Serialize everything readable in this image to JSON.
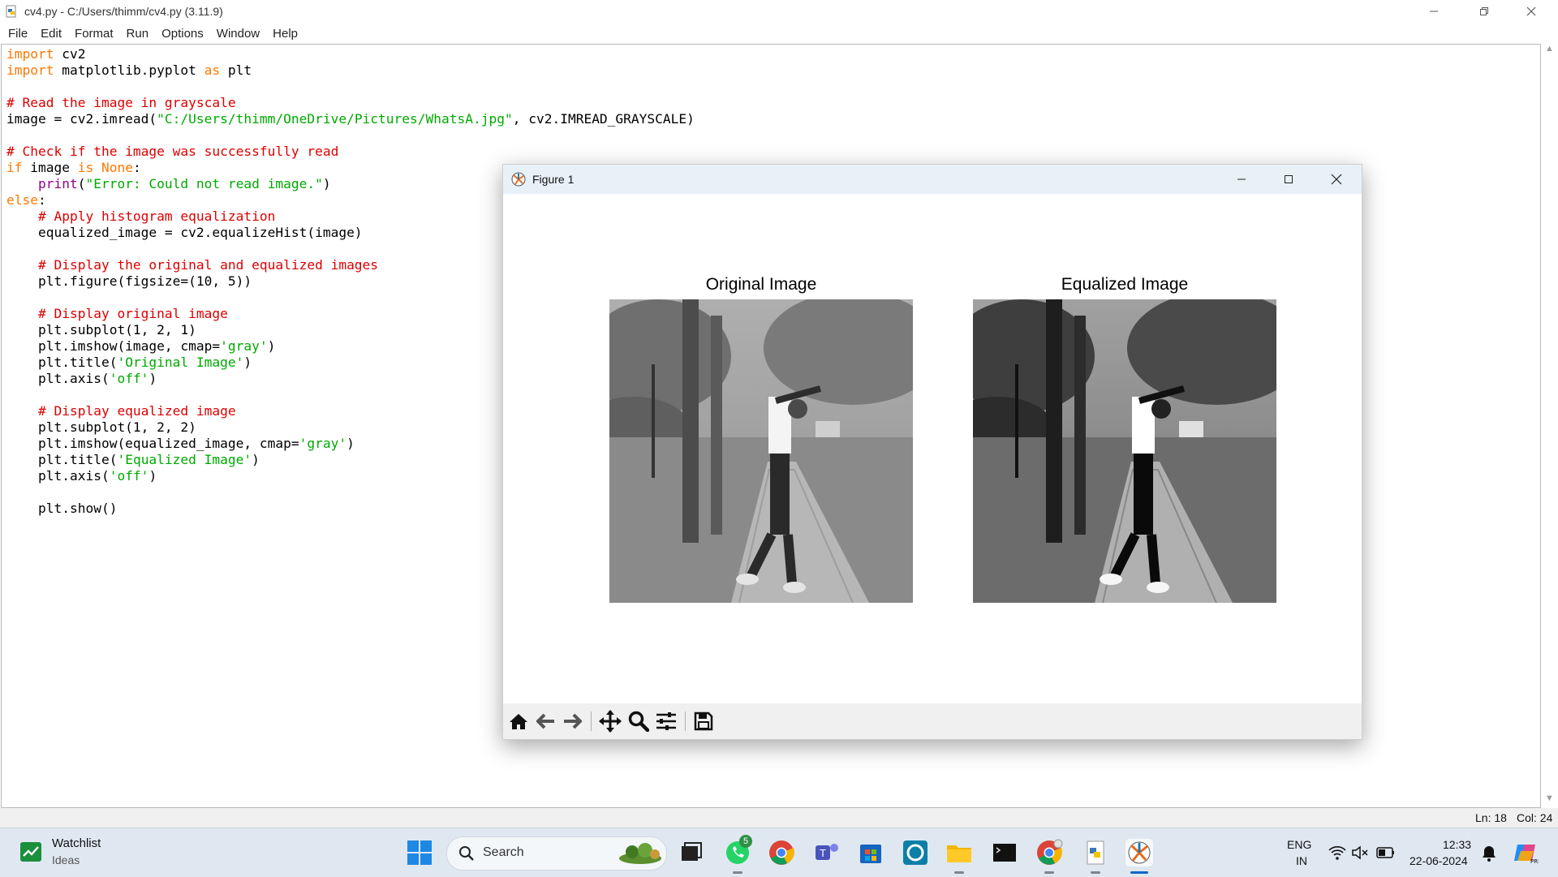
{
  "window": {
    "title": "cv4.py - C:/Users/thimm/cv4.py (3.11.9)",
    "minimize_icon": "minimize-icon",
    "restore_icon": "restore-icon",
    "close_icon": "close-icon"
  },
  "menu": [
    "File",
    "Edit",
    "Format",
    "Run",
    "Options",
    "Window",
    "Help"
  ],
  "code_lines": [
    [
      {
        "t": "import",
        "c": "kw"
      },
      {
        "t": " cv2",
        "c": ""
      }
    ],
    [
      {
        "t": "import",
        "c": "kw"
      },
      {
        "t": " matplotlib.pyplot ",
        "c": ""
      },
      {
        "t": "as",
        "c": "kw"
      },
      {
        "t": " plt",
        "c": ""
      }
    ],
    [],
    [
      {
        "t": "# Read the image in grayscale",
        "c": "cm"
      }
    ],
    [
      {
        "t": "image = cv2.imread(",
        "c": ""
      },
      {
        "t": "\"C:/Users/thimm/OneDrive/Pictures/WhatsA.jpg\"",
        "c": "st"
      },
      {
        "t": ", cv2.IMREAD_GRAYSCALE)",
        "c": ""
      }
    ],
    [],
    [
      {
        "t": "# Check if the image was successfully read",
        "c": "cm"
      }
    ],
    [
      {
        "t": "if",
        "c": "kw"
      },
      {
        "t": " image ",
        "c": ""
      },
      {
        "t": "is",
        "c": "kw"
      },
      {
        "t": " ",
        "c": ""
      },
      {
        "t": "None",
        "c": "kw"
      },
      {
        "t": ":",
        "c": ""
      }
    ],
    [
      {
        "t": "    ",
        "c": ""
      },
      {
        "t": "print",
        "c": "bi"
      },
      {
        "t": "(",
        "c": ""
      },
      {
        "t": "\"Error: Could not read image.\"",
        "c": "st"
      },
      {
        "t": ")",
        "c": ""
      }
    ],
    [
      {
        "t": "else",
        "c": "kw"
      },
      {
        "t": ":",
        "c": ""
      }
    ],
    [
      {
        "t": "    ",
        "c": ""
      },
      {
        "t": "# Apply histogram equalization",
        "c": "cm"
      }
    ],
    [
      {
        "t": "    equalized_image = cv2.equalizeHist(image)",
        "c": ""
      }
    ],
    [],
    [
      {
        "t": "    ",
        "c": ""
      },
      {
        "t": "# Display the original and equalized images",
        "c": "cm"
      }
    ],
    [
      {
        "t": "    plt.figure(figsize=(10, 5))",
        "c": ""
      }
    ],
    [],
    [
      {
        "t": "    ",
        "c": ""
      },
      {
        "t": "# Display original image",
        "c": "cm"
      }
    ],
    [
      {
        "t": "    plt.subplot(1, 2, 1)",
        "c": ""
      }
    ],
    [
      {
        "t": "    plt.imshow(image, cmap=",
        "c": ""
      },
      {
        "t": "'gray'",
        "c": "st"
      },
      {
        "t": ")",
        "c": ""
      }
    ],
    [
      {
        "t": "    plt.title(",
        "c": ""
      },
      {
        "t": "'Original Image'",
        "c": "st"
      },
      {
        "t": ")",
        "c": ""
      }
    ],
    [
      {
        "t": "    plt.axis(",
        "c": ""
      },
      {
        "t": "'off'",
        "c": "st"
      },
      {
        "t": ")",
        "c": ""
      }
    ],
    [],
    [
      {
        "t": "    ",
        "c": ""
      },
      {
        "t": "# Display equalized image",
        "c": "cm"
      }
    ],
    [
      {
        "t": "    plt.subplot(1, 2, 2)",
        "c": ""
      }
    ],
    [
      {
        "t": "    plt.imshow(equalized_image, cmap=",
        "c": ""
      },
      {
        "t": "'gray'",
        "c": "st"
      },
      {
        "t": ")",
        "c": ""
      }
    ],
    [
      {
        "t": "    plt.title(",
        "c": ""
      },
      {
        "t": "'Equalized Image'",
        "c": "st"
      },
      {
        "t": ")",
        "c": ""
      }
    ],
    [
      {
        "t": "    plt.axis(",
        "c": ""
      },
      {
        "t": "'off'",
        "c": "st"
      },
      {
        "t": ")",
        "c": ""
      }
    ],
    [],
    [
      {
        "t": "    plt.show()",
        "c": ""
      }
    ]
  ],
  "status": {
    "line": "Ln: 18",
    "col": "Col: 24"
  },
  "figure": {
    "title": "Figure 1",
    "left_title": "Original Image",
    "right_title": "Equalized Image",
    "toolbar_icons": [
      "home-icon",
      "back-arrow-icon",
      "forward-arrow-icon",
      "pan-icon",
      "zoom-icon",
      "configure-subplots-icon",
      "save-icon"
    ]
  },
  "taskbar": {
    "widget_title": "Watchlist",
    "widget_sub": "Ideas",
    "search_label": "Search",
    "whatsapp_badge": "5",
    "lang_top": "ENG",
    "lang_bottom": "IN",
    "time": "12:33",
    "date": "22-06-2024"
  },
  "colors": {
    "keyword": "#ff7700",
    "comment": "#dd0000",
    "string": "#00aa00",
    "builtin": "#900090",
    "figure_titlebar": "#e9f1f8",
    "taskbar": "#dfe8f1"
  }
}
